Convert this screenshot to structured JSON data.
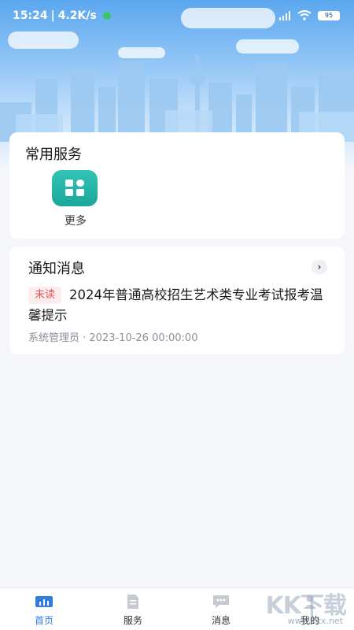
{
  "status_bar": {
    "time": "15:24",
    "speed": "4.2K/s",
    "battery": "95"
  },
  "services": {
    "title": "常用服务",
    "items": [
      {
        "label": "更多",
        "icon": "grid-more-icon"
      }
    ]
  },
  "notices": {
    "title": "通知消息",
    "items": [
      {
        "badge": "未读",
        "text": "2024年普通高校招生艺术类专业考试报考温馨提示",
        "meta": "系统管理员 · 2023-10-26 00:00:00"
      }
    ]
  },
  "tabbar": {
    "items": [
      {
        "label": "首页",
        "icon": "home-icon",
        "active": true
      },
      {
        "label": "服务",
        "icon": "document-icon",
        "active": false
      },
      {
        "label": "消息",
        "icon": "message-icon",
        "active": false
      },
      {
        "label": "我的",
        "icon": "user-icon",
        "active": false
      }
    ]
  },
  "watermark": {
    "brand": "KK下载",
    "url": "www.kkx.net"
  },
  "colors": {
    "accent": "#2f7de0",
    "teal": "#1aa79b",
    "badge_red": "#e05555"
  }
}
